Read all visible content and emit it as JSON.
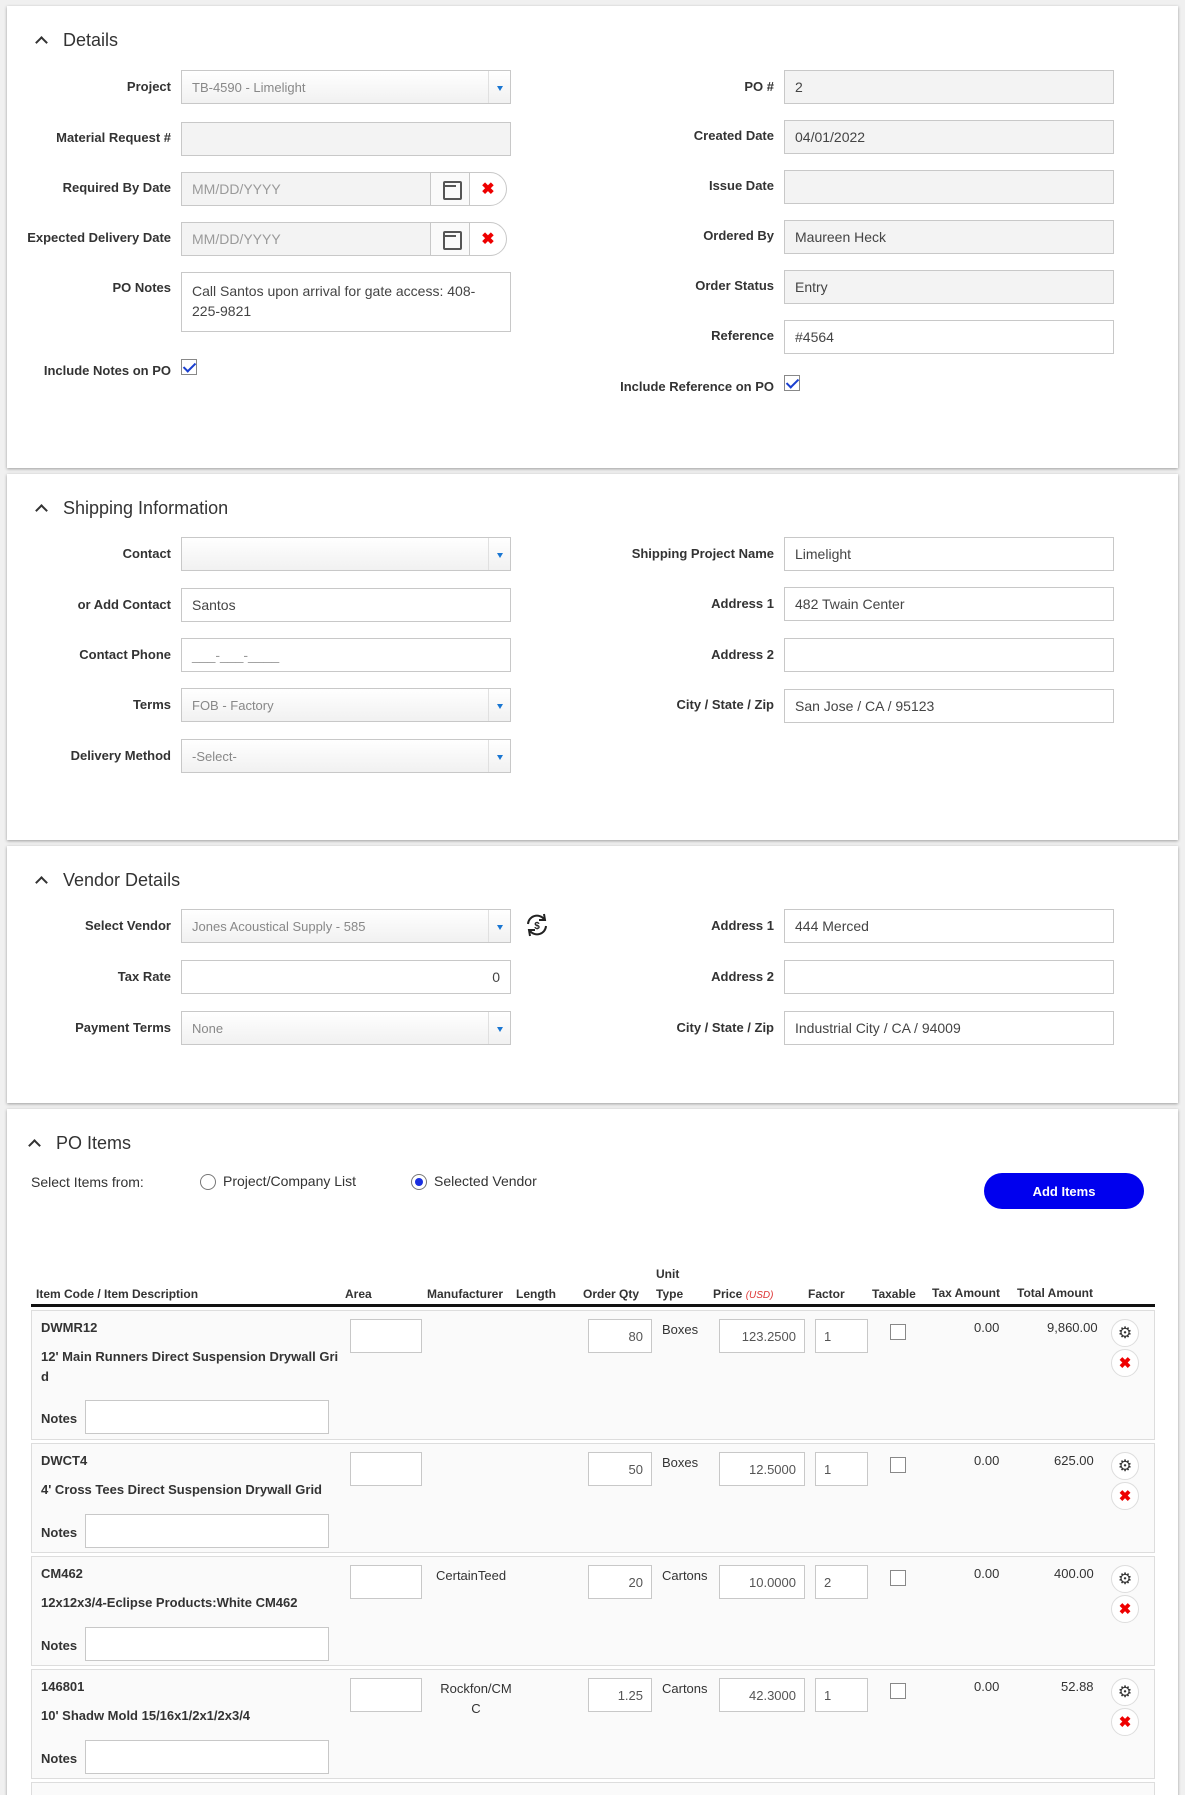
{
  "details": {
    "title": "Details",
    "project_label": "Project",
    "project_value": "TB-4590 - Limelight",
    "mr_label": "Material Request #",
    "mr_value": "",
    "required_label": "Required By Date",
    "required_ph": "MM/DD/YYYY",
    "expected_label": "Expected Delivery Date",
    "expected_ph": "MM/DD/YYYY",
    "notes_label": "PO Notes",
    "notes_value": "Call Santos upon arrival for gate access: 408-225-9821",
    "include_notes_label": "Include Notes on PO",
    "po_label": "PO #",
    "po_value": "2",
    "created_label": "Created Date",
    "created_value": "04/01/2022",
    "issue_label": "Issue Date",
    "issue_value": "",
    "ordered_label": "Ordered By",
    "ordered_value": "Maureen Heck",
    "status_label": "Order Status",
    "status_value": "Entry",
    "ref_label": "Reference",
    "ref_value": "#4564",
    "include_ref_label": "Include Reference on PO"
  },
  "shipping": {
    "title": "Shipping Information",
    "contact_label": "Contact",
    "contact_value": "",
    "add_contact_label": "or Add Contact",
    "add_contact_value": "Santos",
    "phone_label": "Contact Phone",
    "phone_ph": "___-___-____",
    "terms_label": "Terms",
    "terms_value": "FOB - Factory",
    "delivery_label": "Delivery Method",
    "delivery_value": "-Select-",
    "proj_name_label": "Shipping Project Name",
    "proj_name_value": "Limelight",
    "addr1_label": "Address 1",
    "addr1_value": "482 Twain Center",
    "addr2_label": "Address 2",
    "addr2_value": "",
    "city_label": "City / State / Zip",
    "city_value": "San Jose / CA / 95123"
  },
  "vendor": {
    "title": "Vendor Details",
    "select_label": "Select Vendor",
    "select_value": "Jones Acoustical Supply - 585",
    "tax_label": "Tax Rate",
    "tax_value": "0",
    "payment_label": "Payment Terms",
    "payment_value": "None",
    "addr1_label": "Address 1",
    "addr1_value": "444 Merced",
    "addr2_label": "Address 2",
    "addr2_value": "",
    "city_label": "City / State / Zip",
    "city_value": "Industrial City / CA / 94009"
  },
  "po_items": {
    "title": "PO Items",
    "select_from_label": "Select Items from:",
    "option_project": "Project/Company List",
    "option_vendor": "Selected Vendor",
    "add_button": "Add Items",
    "headers": {
      "item": "Item Code / Item Description",
      "area": "Area",
      "manufacturer": "Manufacturer",
      "length": "Length",
      "qty": "Order Qty",
      "unit_type_1": "Unit",
      "unit_type_2": "Type",
      "price": "Price",
      "usd": "(USD)",
      "factor": "Factor",
      "taxable": "Taxable",
      "tax_amount": "Tax Amount",
      "total": "Total Amount"
    },
    "notes_label": "Notes",
    "rows": [
      {
        "code": "DWMR12",
        "desc": "12' Main Runners Direct Suspension Drywall Grid",
        "manufacturer": "",
        "qty": "80",
        "unit": "Boxes",
        "price": "123.2500",
        "factor": "1",
        "tax": "0.00",
        "total": "9,860.00"
      },
      {
        "code": "DWCT4",
        "desc": "4' Cross Tees Direct Suspension Drywall Grid",
        "manufacturer": "",
        "qty": "50",
        "unit": "Boxes",
        "price": "12.5000",
        "factor": "1",
        "tax": "0.00",
        "total": "625.00"
      },
      {
        "code": "CM462",
        "desc": "12x12x3/4-Eclipse Products:White CM462",
        "manufacturer": "CertainTeed",
        "qty": "20",
        "unit": "Cartons",
        "price": "10.0000",
        "factor": "2",
        "tax": "0.00",
        "total": "400.00"
      },
      {
        "code": "146801",
        "desc": "10' Shadw Mold 15/16x1/2x1/2x3/4",
        "manufacturer": "Rockfon/CMC",
        "qty": "1.25",
        "unit": "Cartons",
        "price": "42.3000",
        "factor": "1",
        "tax": "0.00",
        "total": "52.88"
      }
    ]
  }
}
